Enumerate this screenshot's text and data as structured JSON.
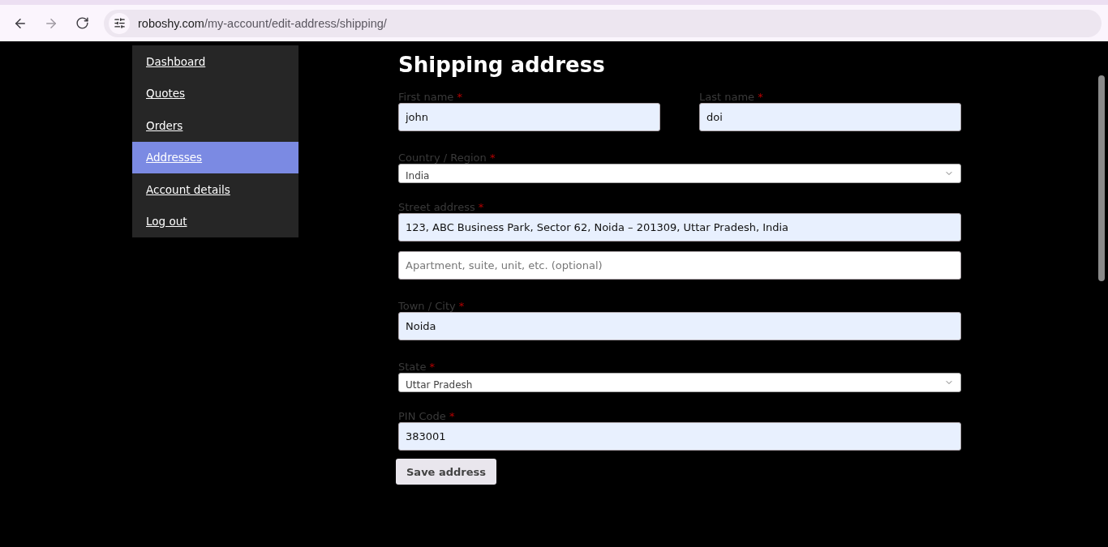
{
  "browser": {
    "url_host": "roboshy.com",
    "url_path": "/my-account/edit-address/shipping/",
    "forward_disabled": true
  },
  "sidebar": {
    "items": [
      {
        "label": "Dashboard",
        "selected": false
      },
      {
        "label": "Quotes",
        "selected": false
      },
      {
        "label": "Orders",
        "selected": false
      },
      {
        "label": "Addresses",
        "selected": true
      },
      {
        "label": "Account details",
        "selected": false
      },
      {
        "label": "Log out",
        "selected": false
      }
    ]
  },
  "form": {
    "title": "Shipping address",
    "rows": [
      {
        "fields": [
          {
            "kind": "text",
            "label": "First name",
            "required_mark": "*",
            "value": "john",
            "filled": true
          },
          {
            "kind": "text",
            "label": "Last name",
            "required_mark": "*",
            "value": "doi",
            "filled": true
          }
        ]
      },
      {
        "fields": [
          {
            "kind": "select",
            "label": "Country / Region",
            "required_mark": "*",
            "value": "India"
          }
        ]
      },
      {
        "fields": [
          {
            "kind": "text",
            "label": "Street address",
            "required_mark": "*",
            "value": "123, ABC Business Park, Sector 62, Noida – 201309, Uttar Pradesh, India",
            "filled": true
          }
        ]
      },
      {
        "fields": [
          {
            "kind": "text",
            "placeholder": "Apartment, suite, unit, etc. (optional)",
            "filled": false
          }
        ]
      },
      {
        "fields": [
          {
            "kind": "text",
            "label": "Town / City",
            "required_mark": "*",
            "value": "Noida",
            "filled": true
          }
        ]
      },
      {
        "fields": [
          {
            "kind": "select",
            "label": "State",
            "required_mark": "*",
            "value": "Uttar Pradesh"
          }
        ]
      },
      {
        "fields": [
          {
            "kind": "text",
            "label": "PIN Code",
            "required_mark": "*",
            "value": "383001",
            "filled": true
          }
        ]
      }
    ],
    "submit": "Save address"
  }
}
